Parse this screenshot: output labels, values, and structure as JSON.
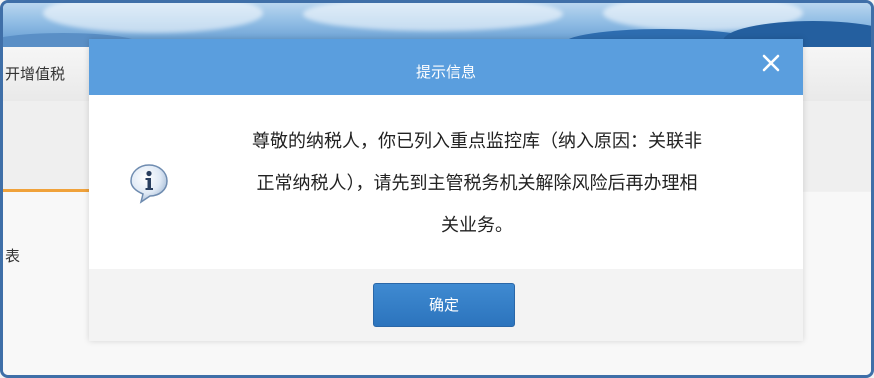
{
  "background": {
    "nav_text": "开增值税",
    "side_text": "表"
  },
  "dialog": {
    "title": "提示信息",
    "close_icon": "close-icon",
    "info_icon": "info-speech-bubble-icon",
    "message_lines": [
      "尊敬的纳税人，你已列入重点监控库（纳入原因：关联非",
      "正常纳税人），请先到主管税务机关解除风险后再办理相",
      "关业务。"
    ],
    "ok_label": "确定"
  },
  "colors": {
    "header": "#5a9ede",
    "button": "#2f78c2",
    "accent_orange": "#f0a23b",
    "frame_border": "#3f6fa8"
  }
}
